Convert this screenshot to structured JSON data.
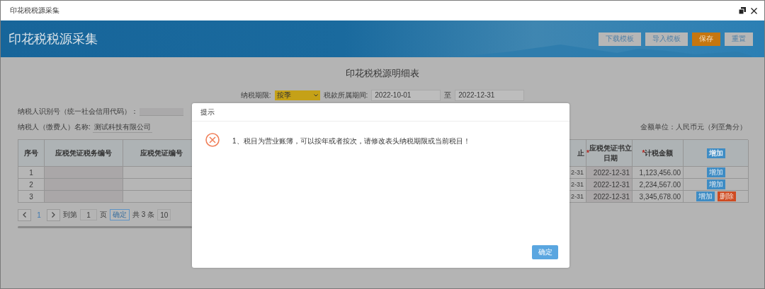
{
  "window": {
    "title": "印花税税源采集"
  },
  "banner": {
    "title": "印花税税源采集",
    "buttons": [
      {
        "label": "下载模板",
        "kind": "default"
      },
      {
        "label": "导入模板",
        "kind": "default"
      },
      {
        "label": "保存",
        "kind": "primary"
      },
      {
        "label": "重置",
        "kind": "default"
      }
    ]
  },
  "report": {
    "title": "印花税税源明细表",
    "period": {
      "label": "纳税期限:",
      "value": "按季"
    },
    "range": {
      "label": "税款所属期间:",
      "start": "2022-10-01",
      "separator": "至",
      "end": "2022-12-31"
    },
    "taxpayer_id": {
      "label": "纳税人识别号（统一社会信用代码）："
    },
    "taxpayer_name": {
      "label": "纳税人（缴费人）名称:",
      "value": "测试科技有限公司"
    },
    "unit_note": "金额单位：人民币元（列至角分）"
  },
  "table": {
    "columns": [
      {
        "label": "序号"
      },
      {
        "label": "应税凭证税务编号"
      },
      {
        "label": "应税凭证编号"
      },
      {
        "label": "止"
      },
      {
        "label": "应税凭证书立日期",
        "marker": "*"
      },
      {
        "label": "计税金额",
        "marker": "*"
      }
    ],
    "header_action": {
      "label": "增加",
      "kind": "add"
    },
    "rows": [
      {
        "index": "1",
        "column_4": "2-31",
        "date": "2022-12-31",
        "amount": "1,123,456.00",
        "actions": [
          {
            "label": "增加",
            "kind": "add"
          }
        ]
      },
      {
        "index": "2",
        "column_4": "2-31",
        "date": "2022-12-31",
        "amount": "2,234,567.00",
        "actions": [
          {
            "label": "增加",
            "kind": "add"
          }
        ]
      },
      {
        "index": "3",
        "column_4": "2-31",
        "date": "2022-12-31",
        "amount": "3,345,678.00",
        "actions": [
          {
            "label": "增加",
            "kind": "add"
          },
          {
            "label": "删除",
            "kind": "delete"
          }
        ]
      }
    ]
  },
  "pagination": {
    "page": "1",
    "goto_label": "到第",
    "goto_value": "1",
    "page_unit": "页",
    "confirm": "确定",
    "total": "共 3 条",
    "page_size": "10"
  },
  "dialog": {
    "title": "提示",
    "message": "1、税目为营业账簿，可以按年或者按次，请修改表头纳税期限或当前税目！",
    "button": "确定"
  }
}
